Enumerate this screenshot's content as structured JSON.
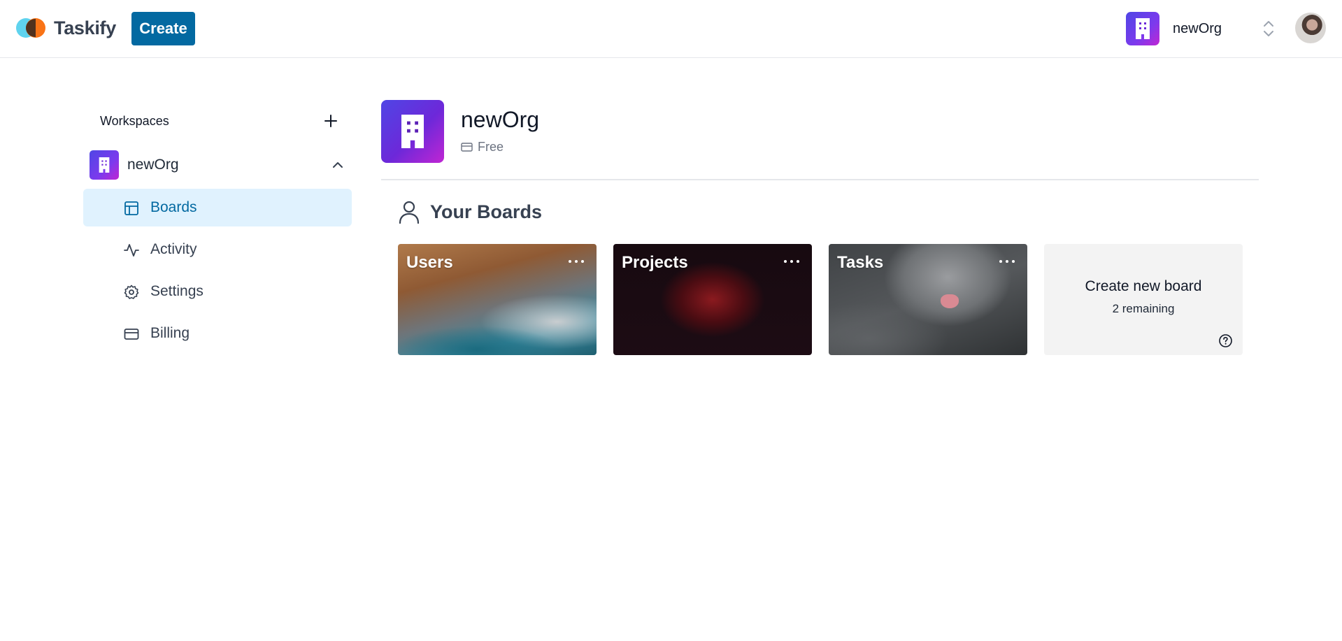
{
  "header": {
    "brand": "Taskify",
    "create_label": "Create",
    "org_switcher": {
      "name": "newOrg"
    }
  },
  "sidebar": {
    "title": "Workspaces",
    "org": {
      "name": "newOrg"
    },
    "items": [
      {
        "label": "Boards",
        "icon": "layout-icon",
        "active": true
      },
      {
        "label": "Activity",
        "icon": "activity-icon"
      },
      {
        "label": "Settings",
        "icon": "gear-icon"
      },
      {
        "label": "Billing",
        "icon": "credit-card-icon"
      }
    ]
  },
  "main": {
    "org_name": "newOrg",
    "plan": "Free",
    "section_title": "Your Boards",
    "boards": [
      {
        "title": "Users"
      },
      {
        "title": "Projects"
      },
      {
        "title": "Tasks"
      }
    ],
    "new_board": {
      "label": "Create new board",
      "remaining": "2 remaining"
    }
  },
  "colors": {
    "primary": "#0369a1",
    "active_bg": "#e0f2fe",
    "org_gradient_start": "#4f46e5",
    "org_gradient_end": "#c026d3"
  }
}
